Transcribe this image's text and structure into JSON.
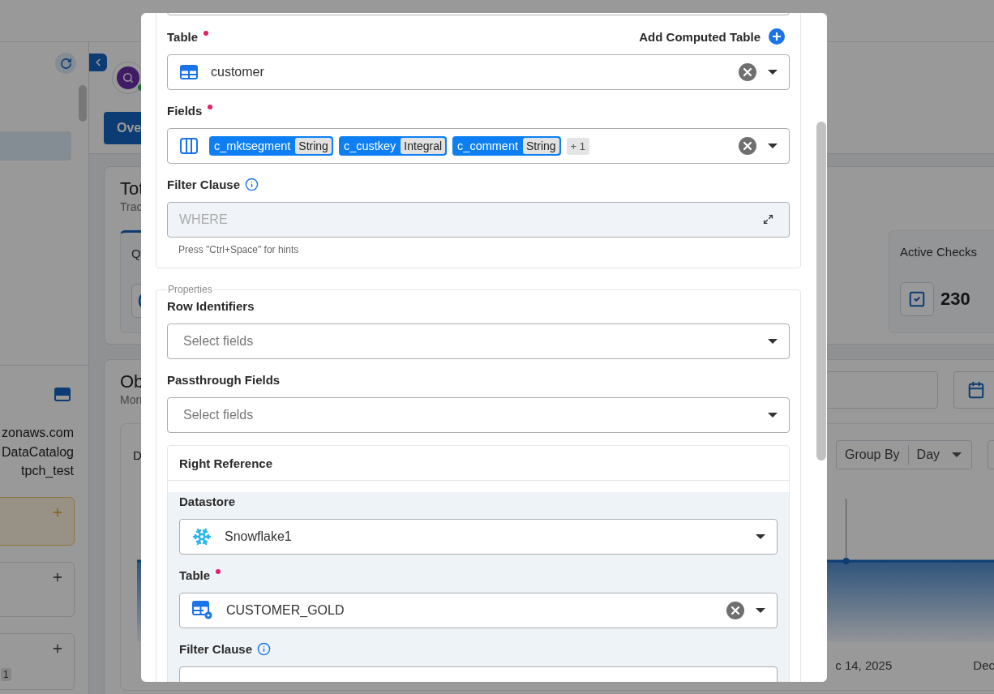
{
  "sidebar": {
    "host_lines": [
      "zonaws.com",
      "DataCatalog",
      "tpch_test"
    ],
    "badge": "1"
  },
  "header": {
    "tab": "Ove"
  },
  "totals": {
    "title": "Tot",
    "subtitle": "Trac",
    "first_stat": "Q",
    "active_checks": {
      "label": "Active Checks",
      "value": "230"
    }
  },
  "observability": {
    "title": "Ob",
    "subtitle": "Mon",
    "chart_title": "D",
    "group_by": {
      "label": "Group By",
      "value": "Day"
    },
    "x_labels": [
      "c 14, 2025",
      "Dec"
    ]
  },
  "modal": {
    "main_table": {
      "label": "Table",
      "required": true,
      "action": "Add Computed Table",
      "value": "customer",
      "clearable": true
    },
    "fields": {
      "label": "Fields",
      "required": true,
      "chips": [
        {
          "name": "c_mktsegment",
          "type": "String"
        },
        {
          "name": "c_custkey",
          "type": "Integral"
        },
        {
          "name": "c_comment",
          "type": "String"
        }
      ],
      "more": "+ 1",
      "clearable": true
    },
    "filter": {
      "label": "Filter Clause",
      "placeholder": "WHERE",
      "hint": "Press \"Ctrl+Space\" for hints"
    },
    "properties": {
      "legend": "Properties",
      "row_identifiers": {
        "label": "Row Identifiers",
        "placeholder": "Select fields"
      },
      "passthrough_fields": {
        "label": "Passthrough Fields",
        "placeholder": "Select fields"
      },
      "right_reference": {
        "title": "Right Reference",
        "datastore": {
          "label": "Datastore",
          "value": "Snowflake1",
          "clearable": false
        },
        "table": {
          "label": "Table",
          "required": true,
          "value": "CUSTOMER_GOLD",
          "clearable": true
        },
        "filter": {
          "label": "Filter Clause"
        }
      }
    }
  }
}
